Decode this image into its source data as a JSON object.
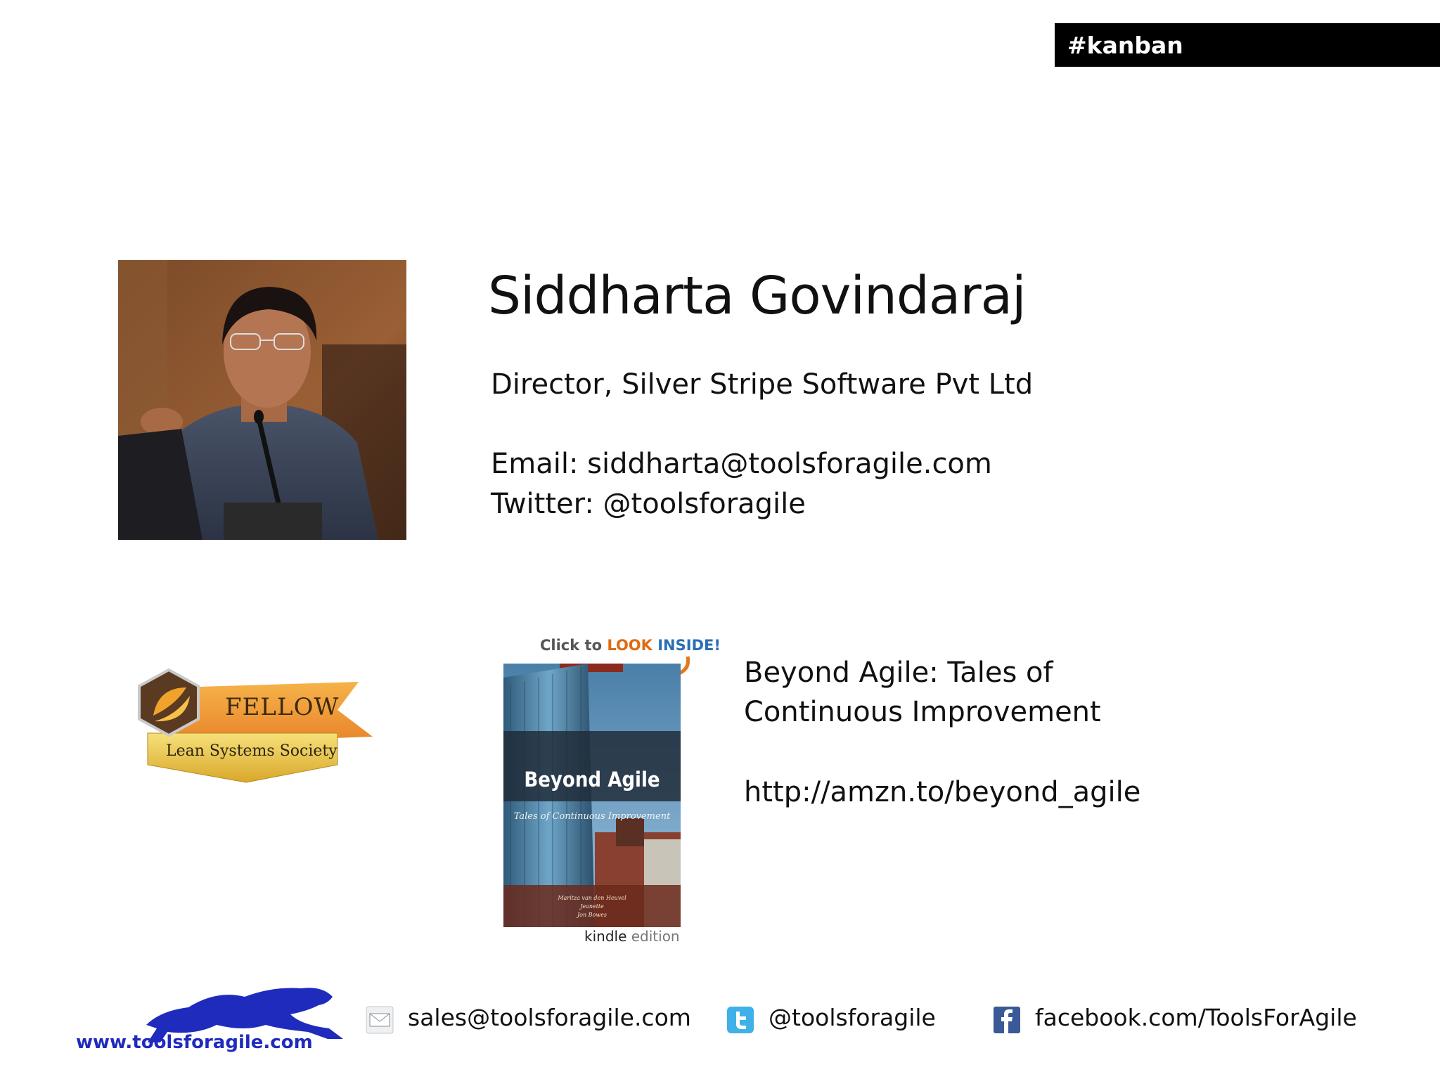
{
  "tag": "#kanban",
  "speaker": {
    "name": "Siddharta Govindaraj",
    "role": "Director, Silver Stripe Software Pvt Ltd",
    "email_line": "Email: siddharta@toolsforagile.com",
    "twitter_line": "Twitter: @toolsforagile"
  },
  "badge": {
    "title": "FELLOW",
    "org": "Lean Systems Society"
  },
  "book": {
    "look_inside": {
      "prefix": "Click to ",
      "look": "LOOK",
      "inside": " INSIDE!"
    },
    "cover_title": "Beyond Agile",
    "cover_subtitle": "Tales of Continuous Improvement",
    "cover_authors": [
      "Maritza van den Heuvel",
      "Jeanette",
      "Jon Bowes"
    ],
    "kindle": "kindle",
    "edition": " edition",
    "title_line1": "Beyond Agile: Tales of",
    "title_line2": "Continuous Improvement",
    "url": "http://amzn.to/beyond_agile"
  },
  "footer": {
    "logo_url": "www.toolsforagile.com",
    "email": "sales@toolsforagile.com",
    "twitter": "@toolsforagile",
    "facebook": "facebook.com/ToolsForAgile",
    "icons": [
      "mail-icon",
      "twitter-icon",
      "facebook-icon"
    ]
  },
  "colors": {
    "tag_bg": "#000000",
    "badge_orange": "#e8832a",
    "badge_gold": "#e7c23a",
    "logo_blue": "#1f2bbd",
    "twitter_blue": "#3fb0e8",
    "facebook_blue": "#3b5998"
  }
}
